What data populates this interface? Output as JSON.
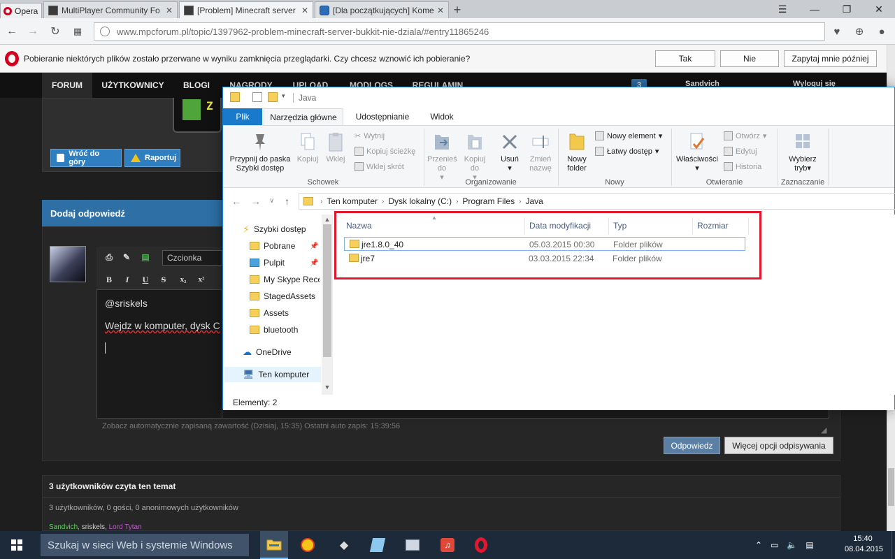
{
  "browser": {
    "menu_label": "Opera",
    "tabs": [
      {
        "title": "MultiPlayer Community Fo",
        "active": false,
        "icon": "mpc-favicon"
      },
      {
        "title": "[Problem] Minecraft server",
        "active": true,
        "icon": "mpc-favicon"
      },
      {
        "title": "[Dla początkujących] Kome",
        "active": false,
        "icon": "blue-favicon"
      }
    ],
    "url": "www.mpcforum.pl/topic/1397962-problem-minecraft-server-bukkit-nie-dziala/#entry11865246",
    "notification": {
      "message": "Pobieranie niektórych plików zostało przerwane w wyniku zamknięcia przeglądarki. Czy chcesz wznowić ich pobieranie?",
      "yes": "Tak",
      "no": "Nie",
      "later": "Zapytaj mnie później"
    }
  },
  "forum": {
    "nav": [
      "FORUM",
      "UŻYTKOWNICY",
      "BLOGI",
      "NAGRODY",
      "UPLOAD",
      "MODLOGS",
      "REGULAMIN"
    ],
    "nav_user": "Sandvich",
    "nav_notif_count": "3",
    "nav_logout": "Wyloguj się",
    "back_to_top": "Wróć do góry",
    "report": "Raportuj",
    "add_reply": "Dodaj odpowiedź",
    "font_select": "Czcionka",
    "editor_lines": [
      "@sriskels",
      "Wejdz w komputer, dysk C"
    ],
    "autosave": "Zobacz automatycznie zapisaną zawartość (Dzisiaj, 15:35) Ostatni auto zapis: 15:39:56",
    "reply_btn": "Odpowiedz",
    "more_options_btn": "Więcej opcji odpisywania",
    "readers_title": "3 użytkowników czyta ten temat",
    "readers_count": "3 użytkowników, 0 gości, 0 anonimowych użytkowników",
    "readers_users": [
      {
        "name": "Sandvich",
        "color": "#5cd65c"
      },
      {
        "name": "sriskels",
        "color": "#cfcfcf"
      },
      {
        "name": "Lord Tytan",
        "color": "#c05ccf"
      }
    ]
  },
  "explorer": {
    "title": "Java",
    "ribbon_tabs": [
      "Plik",
      "Narzędzia główne",
      "Udostępnianie",
      "Widok"
    ],
    "ribbon": {
      "pin": "Przypnij do paska Szybki dostęp",
      "copy": "Kopiuj",
      "paste": "Wklej",
      "cut": "Wytnij",
      "copy_path": "Kopiuj ścieżkę",
      "paste_shortcut": "Wklej skrót",
      "group_clipboard": "Schowek",
      "move_to": "Przenieś do",
      "copy_to": "Kopiuj do",
      "delete": "Usuń",
      "rename": "Zmień nazwę",
      "group_organize": "Organizowanie",
      "new_folder": "Nowy folder",
      "new_item": "Nowy element",
      "easy_access": "Łatwy dostęp",
      "group_new": "Nowy",
      "properties": "Właściwości",
      "open": "Otwórz",
      "edit": "Edytuj",
      "history": "Historia",
      "group_open": "Otwieranie",
      "select_mode": "Wybierz tryb",
      "group_select": "Zaznaczanie"
    },
    "path": [
      "Ten komputer",
      "Dysk lokalny (C:)",
      "Program Files",
      "Java"
    ],
    "nav_items": [
      {
        "label": "Szybki dostęp",
        "icon": "star-icon",
        "pinned": false
      },
      {
        "label": "Pobrane",
        "icon": "download-folder-icon",
        "pinned": true
      },
      {
        "label": "Pulpit",
        "icon": "desktop-folder-icon",
        "pinned": true
      },
      {
        "label": "My Skype Rece",
        "icon": "folder-icon",
        "pinned": false
      },
      {
        "label": "StagedAssets",
        "icon": "folder-icon",
        "pinned": false
      },
      {
        "label": "Assets",
        "icon": "folder-icon",
        "pinned": false
      },
      {
        "label": "bluetooth",
        "icon": "folder-icon",
        "pinned": false
      },
      {
        "label": "OneDrive",
        "icon": "cloud-icon",
        "pinned": false
      },
      {
        "label": "Ten komputer",
        "icon": "computer-icon",
        "pinned": false
      }
    ],
    "columns": [
      "Nazwa",
      "Data modyfikacji",
      "Typ",
      "Rozmiar"
    ],
    "files": [
      {
        "name": "jre1.8.0_40",
        "modified": "05.03.2015 00:30",
        "type": "Folder plików",
        "size": ""
      },
      {
        "name": "jre7",
        "modified": "03.03.2015 22:34",
        "type": "Folder plików",
        "size": ""
      }
    ],
    "status": "Elementy: 2"
  },
  "taskbar": {
    "search_placeholder": "Szukaj w sieci Web i systemie Windows",
    "time": "15:40",
    "date": "08.04.2015"
  },
  "colors": {
    "accent": "#1979ca",
    "highlight_box": "#e3172d",
    "opera_red": "#d2001e"
  }
}
